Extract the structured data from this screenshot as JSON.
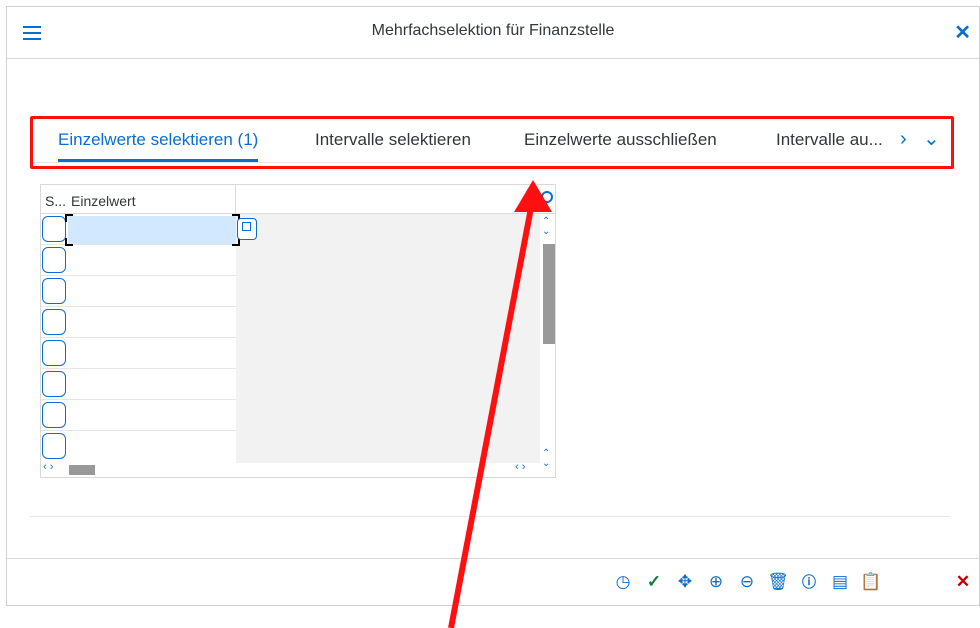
{
  "dialog": {
    "title": "Mehrfachselektion für Finanzstelle"
  },
  "tabs": [
    {
      "label": "Einzelwerte selektieren (1)",
      "active": true
    },
    {
      "label": "Intervalle selektieren",
      "active": false
    },
    {
      "label": "Einzelwerte ausschließen",
      "active": false
    },
    {
      "label": "Intervalle au...",
      "active": false
    }
  ],
  "grid": {
    "col_select": "S...",
    "col_value": "Einzelwert",
    "row_count": 8,
    "first_value": ""
  },
  "colors": {
    "accent": "#0a6ed1",
    "annotation": "#ff1010",
    "selected_cell": "#d1e8ff"
  },
  "icons": {
    "menu": "hamburger-icon",
    "close": "close-icon",
    "settings": "gear-icon",
    "value_help": "value-help-icon",
    "toolbar": [
      "clock-icon",
      "check-icon",
      "move-icon",
      "plus-circle-icon",
      "minus-circle-icon",
      "trash-icon",
      "info-icon",
      "comment-icon",
      "clipboard-icon",
      "cancel-icon"
    ]
  }
}
